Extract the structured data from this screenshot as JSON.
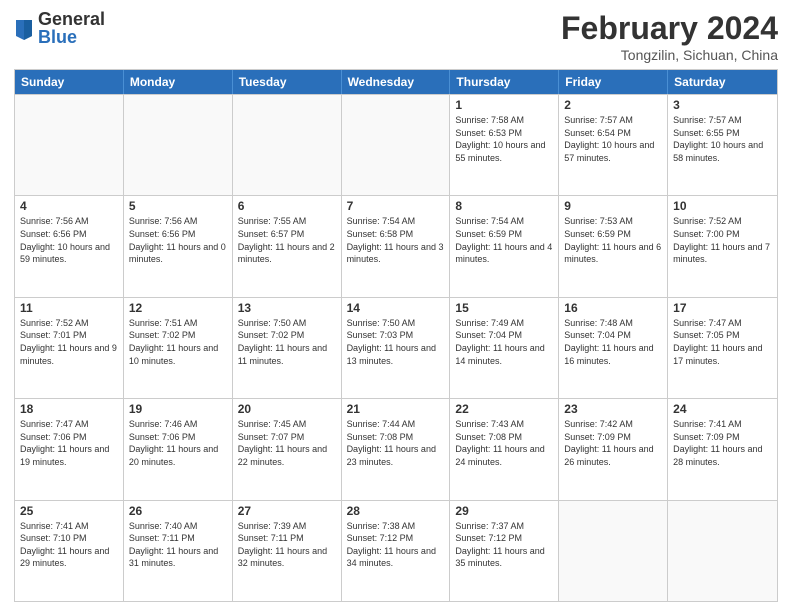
{
  "logo": {
    "general": "General",
    "blue": "Blue"
  },
  "title": "February 2024",
  "location": "Tongzilin, Sichuan, China",
  "days_of_week": [
    "Sunday",
    "Monday",
    "Tuesday",
    "Wednesday",
    "Thursday",
    "Friday",
    "Saturday"
  ],
  "weeks": [
    [
      {
        "day": "",
        "info": ""
      },
      {
        "day": "",
        "info": ""
      },
      {
        "day": "",
        "info": ""
      },
      {
        "day": "",
        "info": ""
      },
      {
        "day": "1",
        "info": "Sunrise: 7:58 AM\nSunset: 6:53 PM\nDaylight: 10 hours and 55 minutes."
      },
      {
        "day": "2",
        "info": "Sunrise: 7:57 AM\nSunset: 6:54 PM\nDaylight: 10 hours and 57 minutes."
      },
      {
        "day": "3",
        "info": "Sunrise: 7:57 AM\nSunset: 6:55 PM\nDaylight: 10 hours and 58 minutes."
      }
    ],
    [
      {
        "day": "4",
        "info": "Sunrise: 7:56 AM\nSunset: 6:56 PM\nDaylight: 10 hours and 59 minutes."
      },
      {
        "day": "5",
        "info": "Sunrise: 7:56 AM\nSunset: 6:56 PM\nDaylight: 11 hours and 0 minutes."
      },
      {
        "day": "6",
        "info": "Sunrise: 7:55 AM\nSunset: 6:57 PM\nDaylight: 11 hours and 2 minutes."
      },
      {
        "day": "7",
        "info": "Sunrise: 7:54 AM\nSunset: 6:58 PM\nDaylight: 11 hours and 3 minutes."
      },
      {
        "day": "8",
        "info": "Sunrise: 7:54 AM\nSunset: 6:59 PM\nDaylight: 11 hours and 4 minutes."
      },
      {
        "day": "9",
        "info": "Sunrise: 7:53 AM\nSunset: 6:59 PM\nDaylight: 11 hours and 6 minutes."
      },
      {
        "day": "10",
        "info": "Sunrise: 7:52 AM\nSunset: 7:00 PM\nDaylight: 11 hours and 7 minutes."
      }
    ],
    [
      {
        "day": "11",
        "info": "Sunrise: 7:52 AM\nSunset: 7:01 PM\nDaylight: 11 hours and 9 minutes."
      },
      {
        "day": "12",
        "info": "Sunrise: 7:51 AM\nSunset: 7:02 PM\nDaylight: 11 hours and 10 minutes."
      },
      {
        "day": "13",
        "info": "Sunrise: 7:50 AM\nSunset: 7:02 PM\nDaylight: 11 hours and 11 minutes."
      },
      {
        "day": "14",
        "info": "Sunrise: 7:50 AM\nSunset: 7:03 PM\nDaylight: 11 hours and 13 minutes."
      },
      {
        "day": "15",
        "info": "Sunrise: 7:49 AM\nSunset: 7:04 PM\nDaylight: 11 hours and 14 minutes."
      },
      {
        "day": "16",
        "info": "Sunrise: 7:48 AM\nSunset: 7:04 PM\nDaylight: 11 hours and 16 minutes."
      },
      {
        "day": "17",
        "info": "Sunrise: 7:47 AM\nSunset: 7:05 PM\nDaylight: 11 hours and 17 minutes."
      }
    ],
    [
      {
        "day": "18",
        "info": "Sunrise: 7:47 AM\nSunset: 7:06 PM\nDaylight: 11 hours and 19 minutes."
      },
      {
        "day": "19",
        "info": "Sunrise: 7:46 AM\nSunset: 7:06 PM\nDaylight: 11 hours and 20 minutes."
      },
      {
        "day": "20",
        "info": "Sunrise: 7:45 AM\nSunset: 7:07 PM\nDaylight: 11 hours and 22 minutes."
      },
      {
        "day": "21",
        "info": "Sunrise: 7:44 AM\nSunset: 7:08 PM\nDaylight: 11 hours and 23 minutes."
      },
      {
        "day": "22",
        "info": "Sunrise: 7:43 AM\nSunset: 7:08 PM\nDaylight: 11 hours and 24 minutes."
      },
      {
        "day": "23",
        "info": "Sunrise: 7:42 AM\nSunset: 7:09 PM\nDaylight: 11 hours and 26 minutes."
      },
      {
        "day": "24",
        "info": "Sunrise: 7:41 AM\nSunset: 7:09 PM\nDaylight: 11 hours and 28 minutes."
      }
    ],
    [
      {
        "day": "25",
        "info": "Sunrise: 7:41 AM\nSunset: 7:10 PM\nDaylight: 11 hours and 29 minutes."
      },
      {
        "day": "26",
        "info": "Sunrise: 7:40 AM\nSunset: 7:11 PM\nDaylight: 11 hours and 31 minutes."
      },
      {
        "day": "27",
        "info": "Sunrise: 7:39 AM\nSunset: 7:11 PM\nDaylight: 11 hours and 32 minutes."
      },
      {
        "day": "28",
        "info": "Sunrise: 7:38 AM\nSunset: 7:12 PM\nDaylight: 11 hours and 34 minutes."
      },
      {
        "day": "29",
        "info": "Sunrise: 7:37 AM\nSunset: 7:12 PM\nDaylight: 11 hours and 35 minutes."
      },
      {
        "day": "",
        "info": ""
      },
      {
        "day": "",
        "info": ""
      }
    ]
  ]
}
